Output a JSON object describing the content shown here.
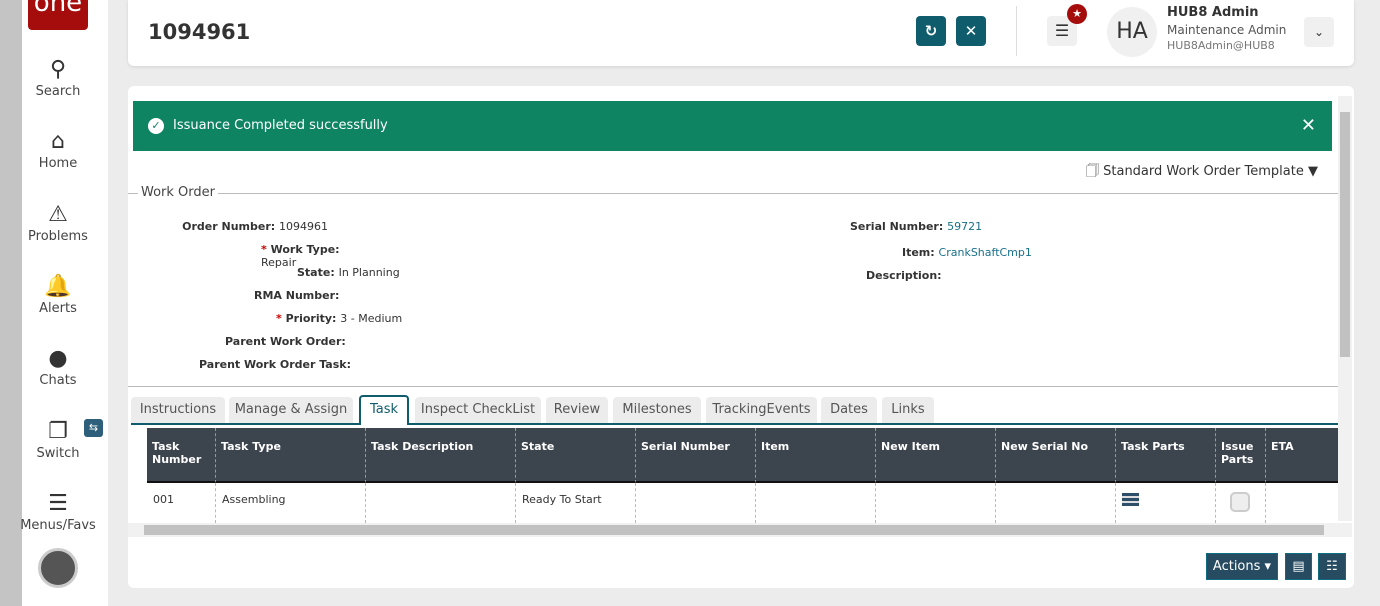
{
  "sidebar": {
    "logo": "one",
    "items": [
      {
        "label": "Search",
        "icon": "search-icon"
      },
      {
        "label": "Home",
        "icon": "home-icon"
      },
      {
        "label": "Problems",
        "icon": "warning-icon"
      },
      {
        "label": "Alerts",
        "icon": "bell-icon"
      },
      {
        "label": "Chats",
        "icon": "chat-icon"
      },
      {
        "label": "Switch",
        "icon": "switch-icon"
      },
      {
        "label": "Menus/Favs",
        "icon": "menu-icon"
      }
    ]
  },
  "header": {
    "title": "1094961",
    "user": {
      "initials": "HA",
      "name": "HUB8 Admin",
      "role": "Maintenance Admin",
      "email": "HUB8Admin@HUB8"
    }
  },
  "alert": {
    "message": "Issuance Completed successfully"
  },
  "template": {
    "label": "Standard Work Order Template"
  },
  "work_order": {
    "legend": "Work Order",
    "left": [
      {
        "label": "Order Number:",
        "value": "1094961",
        "required": false
      },
      {
        "label": "Work Type:",
        "value": "Repair",
        "required": true
      },
      {
        "label": "State:",
        "value": "In Planning",
        "required": false
      },
      {
        "label": "RMA Number:",
        "value": "",
        "required": false
      },
      {
        "label": "Priority:",
        "value": "3 - Medium",
        "required": true
      },
      {
        "label": "Parent Work Order:",
        "value": "",
        "required": false
      },
      {
        "label": "Parent Work Order Task:",
        "value": "",
        "required": false
      }
    ],
    "right": [
      {
        "label": "Serial Number:",
        "value": "59721"
      },
      {
        "label": "Item:",
        "value": "CrankShaftCmp1"
      },
      {
        "label": "Description:",
        "value": ""
      }
    ]
  },
  "tabs": [
    "Instructions",
    "Manage & Assign",
    "Task",
    "Inspect CheckList",
    "Review",
    "Milestones",
    "TrackingEvents",
    "Dates",
    "Links"
  ],
  "active_tab": "Task",
  "table": {
    "columns": [
      "Task Number",
      "Task Type",
      "Task Description",
      "State",
      "Serial Number",
      "Item",
      "New Item",
      "New Serial No",
      "Task Parts",
      "Issue Parts",
      "ETA"
    ],
    "rows": [
      [
        "001",
        "Assembling",
        "",
        "Ready To Start",
        "",
        "",
        "",
        "",
        "",
        "",
        ""
      ]
    ]
  },
  "footer": {
    "actions_label": "Actions"
  }
}
